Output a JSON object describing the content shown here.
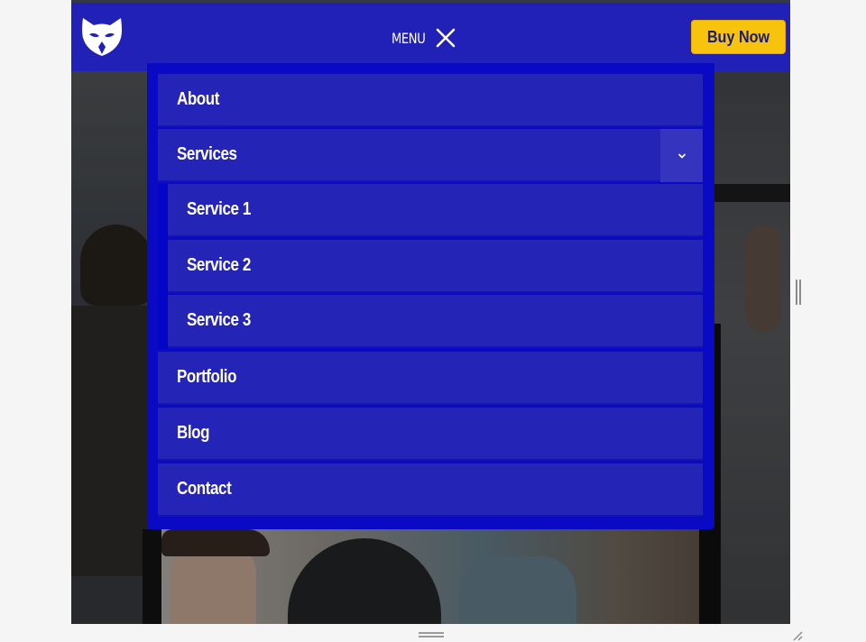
{
  "header": {
    "logo_icon": "cat-mask-logo-icon",
    "menu_label": "MENU",
    "close_icon": "close-x-icon",
    "buy_label": "Buy Now"
  },
  "menu": {
    "items": [
      {
        "label": "About"
      },
      {
        "label": "Services",
        "has_submenu": true,
        "expanded": true,
        "toggle_icon": "chevron-down-icon"
      },
      {
        "label": "Service 1",
        "submenu_of": "Services"
      },
      {
        "label": "Service 2",
        "submenu_of": "Services"
      },
      {
        "label": "Service 3",
        "submenu_of": "Services"
      },
      {
        "label": "Portfolio"
      },
      {
        "label": "Blog"
      },
      {
        "label": "Contact"
      }
    ]
  },
  "colors": {
    "header_bg": "#2121b8",
    "menu_panel_bg": "#0a0ac4",
    "menu_item_bg": "#2424b7",
    "buy_button_bg": "#f8c30c",
    "buy_button_text": "#1a1a7a"
  },
  "icons": {
    "vertical_resize_handle": "drag-handle-vertical-icon",
    "bottom_resize_handle": "drag-handle-horizontal-icon",
    "corner_resize": "resize-corner-icon"
  }
}
